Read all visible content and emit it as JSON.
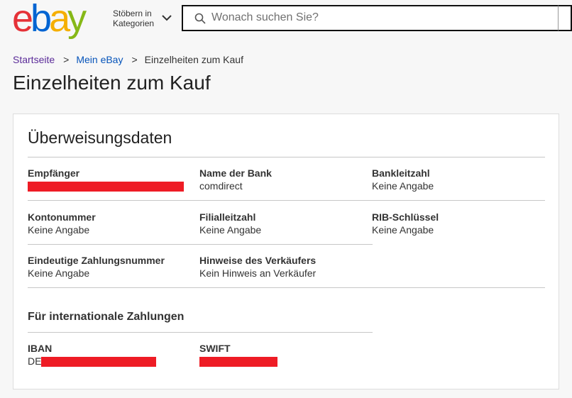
{
  "header": {
    "logo": {
      "e1": "e",
      "b": "b",
      "a": "a",
      "y": "y"
    },
    "categories_line1": "Stöbern in",
    "categories_line2": "Kategorien",
    "search_placeholder": "Wonach suchen Sie?"
  },
  "breadcrumb": {
    "home": "Startseite",
    "sep1": ">",
    "my_ebay": "Mein eBay",
    "sep2": ">",
    "current": "Einzelheiten zum Kauf"
  },
  "page_title": "Einzelheiten zum Kauf",
  "card": {
    "title": "Überweisungsdaten",
    "fields": {
      "recipient": {
        "label": "Empfänger"
      },
      "bank_name": {
        "label": "Name der Bank",
        "value": "comdirect"
      },
      "bank_code": {
        "label": "Bankleitzahl",
        "value": "Keine Angabe"
      },
      "account_number": {
        "label": "Kontonummer",
        "value": "Keine Angabe"
      },
      "branch_code": {
        "label": "Filialleitzahl",
        "value": "Keine Angabe"
      },
      "rib_key": {
        "label": "RIB-Schlüssel",
        "value": "Keine Angabe"
      },
      "payment_id": {
        "label": "Eindeutige Zahlungsnummer",
        "value": "Keine Angabe"
      },
      "seller_notes": {
        "label": "Hinweise des Verkäufers",
        "value": "Kein Hinweis an Verkäufer"
      }
    },
    "international": {
      "title": "Für internationale Zahlungen",
      "iban": {
        "label": "IBAN",
        "value_prefix": "DE"
      },
      "swift": {
        "label": "SWIFT"
      }
    }
  },
  "colors": {
    "redaction": "#ee1c25"
  }
}
